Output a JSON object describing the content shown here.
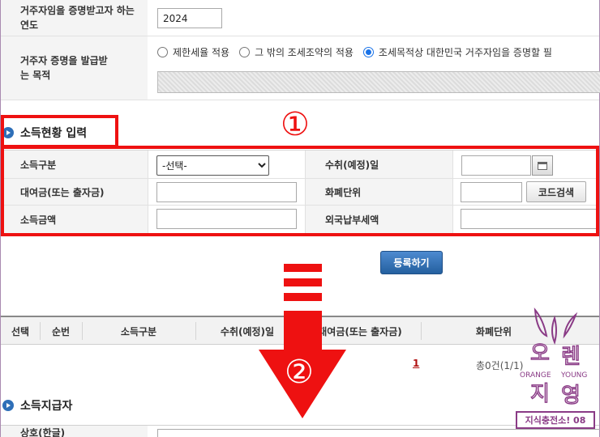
{
  "top_form": {
    "year_label": "거주자임을 증명받고자 하는 연도",
    "year_value": "2024",
    "purpose_label": "거주자 증명을 발급받는 목적",
    "purpose_options": [
      "제한세율 적용",
      "그 밖의 조세조약의 적용",
      "조세목적상 대한민국 거주자임을 증명할 필"
    ],
    "purpose_selected": 2
  },
  "income_section": {
    "title": "소득현황 입력",
    "fields": {
      "income_type_label": "소득구분",
      "income_type_value": "-선택-",
      "receipt_date_label": "수취(예정)일",
      "loan_label": "대여금(또는 출자금)",
      "currency_label": "화폐단위",
      "code_search_button": "코드검색",
      "income_amount_label": "소득금액",
      "foreign_tax_label": "외국납부세액"
    },
    "register_button": "등록하기"
  },
  "results_grid": {
    "columns": [
      "선택",
      "순번",
      "소득구분",
      "수취(예정)일",
      "대여금(또는 출자금)",
      "화폐단위"
    ],
    "page": "1",
    "total": "총0건(1/1)"
  },
  "payer_section": {
    "title": "소득지급자",
    "first_label": "상호(한글)"
  },
  "annotations": {
    "marker_1": "①",
    "marker_2": "②",
    "color": "#ee1111"
  },
  "watermark": {
    "chars": [
      "오",
      "렌",
      "지",
      "영"
    ],
    "orange_text": "ORANGE",
    "young_text": "YOUNG",
    "tag": "지식충전소! 08",
    "color": "#8a3b86"
  }
}
